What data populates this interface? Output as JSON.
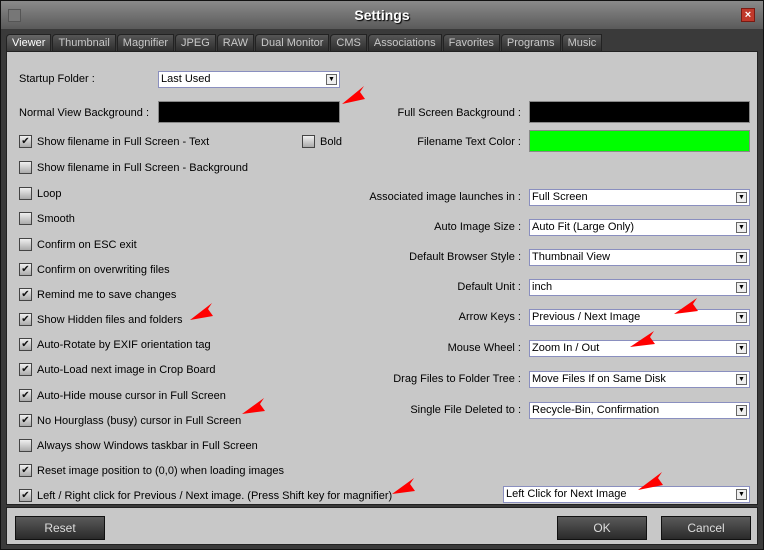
{
  "window": {
    "title": "Settings"
  },
  "tabs": [
    "Viewer",
    "Thumbnail",
    "Magnifier",
    "JPEG",
    "RAW",
    "Dual Monitor",
    "CMS",
    "Associations",
    "Favorites",
    "Programs",
    "Music"
  ],
  "active_tab": "Viewer",
  "startup": {
    "label": "Startup Folder :",
    "value": "Last Used"
  },
  "normal_bg": {
    "label": "Normal View Background :",
    "color": "#000000"
  },
  "fullscreen_bg": {
    "label": "Full Screen Background :",
    "color": "#000000"
  },
  "filename_color": {
    "label": "Filename Text Color :",
    "color": "#00ff00"
  },
  "bold": {
    "label": "Bold",
    "checked": false
  },
  "checkboxes": [
    {
      "label": "Show filename in Full Screen - Text",
      "checked": true
    },
    {
      "label": "Show filename in Full Screen - Background",
      "checked": false
    },
    {
      "label": "Loop",
      "checked": false
    },
    {
      "label": "Smooth",
      "checked": false
    },
    {
      "label": "Confirm on ESC exit",
      "checked": false
    },
    {
      "label": "Confirm on overwriting files",
      "checked": true
    },
    {
      "label": "Remind me to save changes",
      "checked": true
    },
    {
      "label": "Show Hidden files and folders",
      "checked": true
    },
    {
      "label": "Auto-Rotate by EXIF orientation tag",
      "checked": true
    },
    {
      "label": "Auto-Load next image in Crop Board",
      "checked": true
    },
    {
      "label": "Auto-Hide mouse cursor in Full Screen",
      "checked": true
    },
    {
      "label": "No Hourglass (busy) cursor in Full Screen",
      "checked": true
    },
    {
      "label": "Always show Windows taskbar in Full Screen",
      "checked": false
    },
    {
      "label": "Reset image position to (0,0) when loading images",
      "checked": true
    },
    {
      "label": "Left / Right click for Previous / Next image. (Press Shift key for magnifier)",
      "checked": true
    }
  ],
  "dropdowns": [
    {
      "label": "Associated image launches in :",
      "value": "Full Screen"
    },
    {
      "label": "Auto Image Size :",
      "value": "Auto Fit (Large Only)"
    },
    {
      "label": "Default Browser Style :",
      "value": "Thumbnail View"
    },
    {
      "label": "Default Unit :",
      "value": "inch"
    },
    {
      "label": "Arrow Keys :",
      "value": "Previous / Next Image"
    },
    {
      "label": "Mouse Wheel :",
      "value": "Zoom In / Out"
    },
    {
      "label": "Drag Files to Folder Tree :",
      "value": "Move Files If on Same Disk"
    },
    {
      "label": "Single File Deleted to :",
      "value": "Recycle-Bin, Confirmation"
    }
  ],
  "click_mode": {
    "value": "Left Click for Next Image"
  },
  "buttons": {
    "reset": "Reset",
    "ok": "OK",
    "cancel": "Cancel"
  },
  "annotation_color": "#ff0000"
}
